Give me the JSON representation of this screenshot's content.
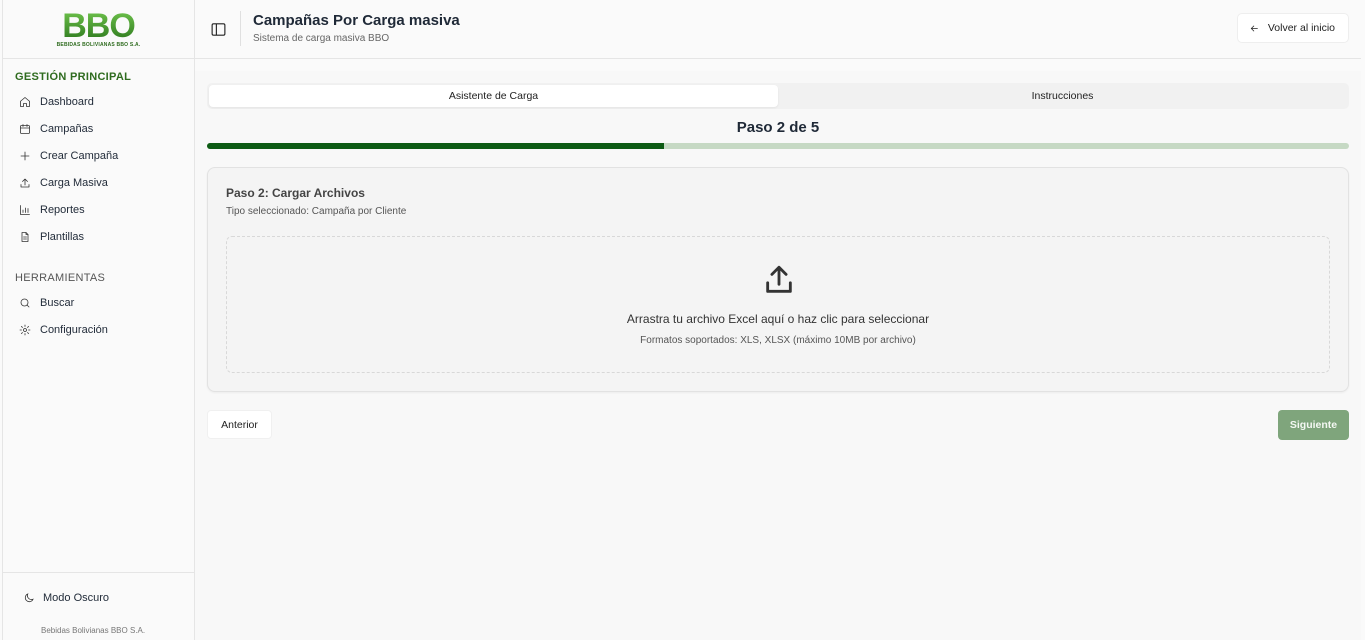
{
  "brand": {
    "logo_text": "BBO",
    "logo_subtext": "BEBIDAS BOLIVIANAS BBO S.A.",
    "company_name": "Bebidas Bolivianas BBO S.A."
  },
  "sidebar": {
    "main_section_title": "GESTIÓN PRINCIPAL",
    "main_items": [
      {
        "label": "Dashboard",
        "icon": "home-icon"
      },
      {
        "label": "Campañas",
        "icon": "calendar-icon"
      },
      {
        "label": "Crear Campaña",
        "icon": "plus-icon"
      },
      {
        "label": "Carga Masiva",
        "icon": "upload-icon"
      },
      {
        "label": "Reportes",
        "icon": "bar-chart-icon"
      },
      {
        "label": "Plantillas",
        "icon": "file-text-icon"
      }
    ],
    "tools_section_title": "HERRAMIENTAS",
    "tools_items": [
      {
        "label": "Buscar",
        "icon": "search-icon"
      },
      {
        "label": "Configuración",
        "icon": "gear-icon"
      }
    ],
    "dark_mode_label": "Modo Oscuro"
  },
  "header": {
    "title": "Campañas Por Carga masiva",
    "subtitle": "Sistema de carga masiva BBO",
    "back_label": "Volver al inicio"
  },
  "tabs": [
    {
      "label": "Asistente de Carga",
      "active": true
    },
    {
      "label": "Instrucciones",
      "active": false
    }
  ],
  "wizard": {
    "step_label": "Paso 2 de 5",
    "progress_fraction": 0.4
  },
  "card": {
    "title": "Paso 2: Cargar Archivos",
    "subtitle": "Tipo seleccionado: Campaña por Cliente",
    "drop_text": "Arrastra tu archivo Excel aquí o haz clic para seleccionar",
    "drop_hint": "Formatos soportados: XLS, XLSX (máximo 10MB por archivo)"
  },
  "buttons": {
    "previous": "Anterior",
    "next": "Siguiente"
  },
  "colors": {
    "brand_green": "#2e6b1e",
    "progress_fill": "#0d5b14",
    "progress_track": "#c6d9c4",
    "next_button": "#7fa57c"
  }
}
